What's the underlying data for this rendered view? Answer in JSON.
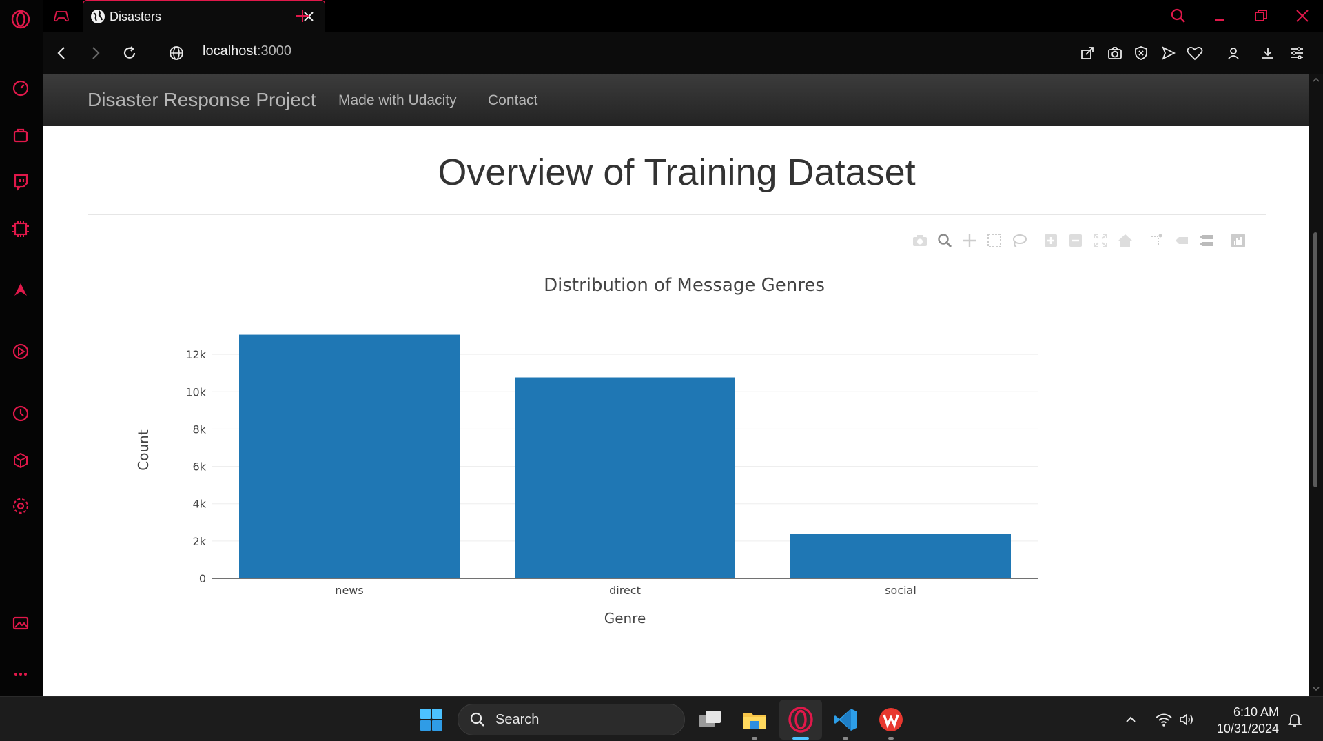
{
  "browser": {
    "tab_title": "Disasters",
    "url_host": "localhost",
    "url_port": ":3000"
  },
  "navbar": {
    "brand": "Disaster Response Project",
    "links": [
      "Made with Udacity",
      "Contact"
    ]
  },
  "page": {
    "title": "Overview of Training Dataset"
  },
  "colors": {
    "accent": "#e0184a",
    "bar": "#1f77b4",
    "grid": "#eeeeee"
  },
  "chart_data": {
    "type": "bar",
    "title": "Distribution of Message Genres",
    "xlabel": "Genre",
    "ylabel": "Count",
    "categories": [
      "news",
      "direct",
      "social"
    ],
    "values": [
      13054,
      10766,
      2396
    ],
    "ylim": [
      0,
      13740
    ],
    "yticks": [
      0,
      2000,
      4000,
      6000,
      8000,
      10000,
      12000
    ],
    "ytick_labels": [
      "0",
      "2k",
      "4k",
      "6k",
      "8k",
      "10k",
      "12k"
    ],
    "grid": true
  },
  "taskbar": {
    "search_label": "Search",
    "time": "6:10 AM",
    "date": "10/31/2024"
  }
}
